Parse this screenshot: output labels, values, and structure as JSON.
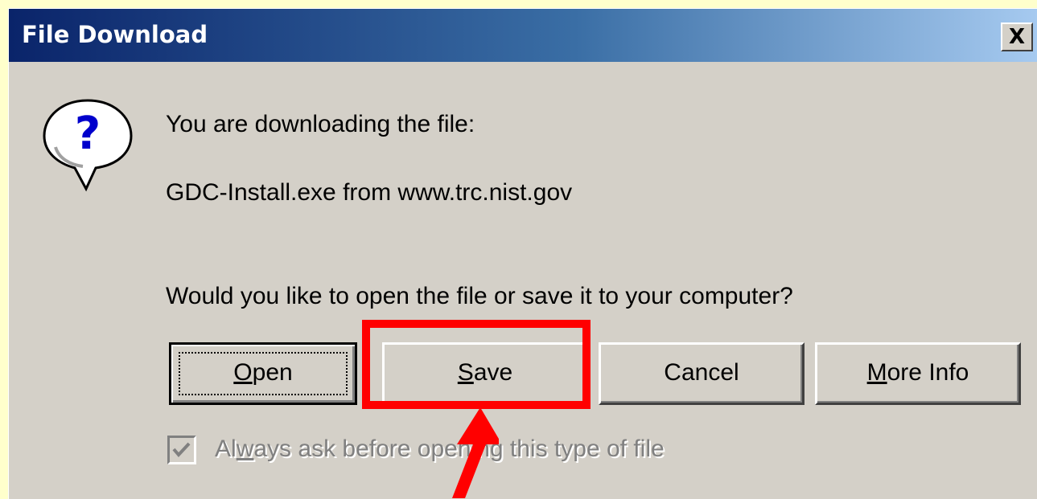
{
  "dialog": {
    "title": "File Download",
    "close_label": "X",
    "icon": "question-icon"
  },
  "message": {
    "line1": "You are downloading the file:",
    "line2": "GDC-Install.exe from www.trc.nist.gov",
    "question": "Would you like to open the file or save it to your computer?"
  },
  "buttons": {
    "open": {
      "mnemonic": "O",
      "rest": "pen"
    },
    "save": {
      "mnemonic": "S",
      "rest": "ave"
    },
    "cancel": {
      "label": "Cancel"
    },
    "more_info": {
      "mnemonic": "M",
      "rest": "ore Info"
    }
  },
  "checkbox": {
    "checked": true,
    "label_pre": "Al",
    "label_mnemonic": "w",
    "label_post": "ays ask before opening this type of file"
  },
  "annotation": {
    "highlight_color": "#FF0000",
    "highlight_target": "save-button",
    "arrow_icon": "arrow-pointer"
  },
  "colors": {
    "page_background": "#FFFFCC",
    "dialog_background": "#D4D0C8",
    "titlebar_start": "#0A246A",
    "titlebar_end": "#A6CAF0"
  }
}
